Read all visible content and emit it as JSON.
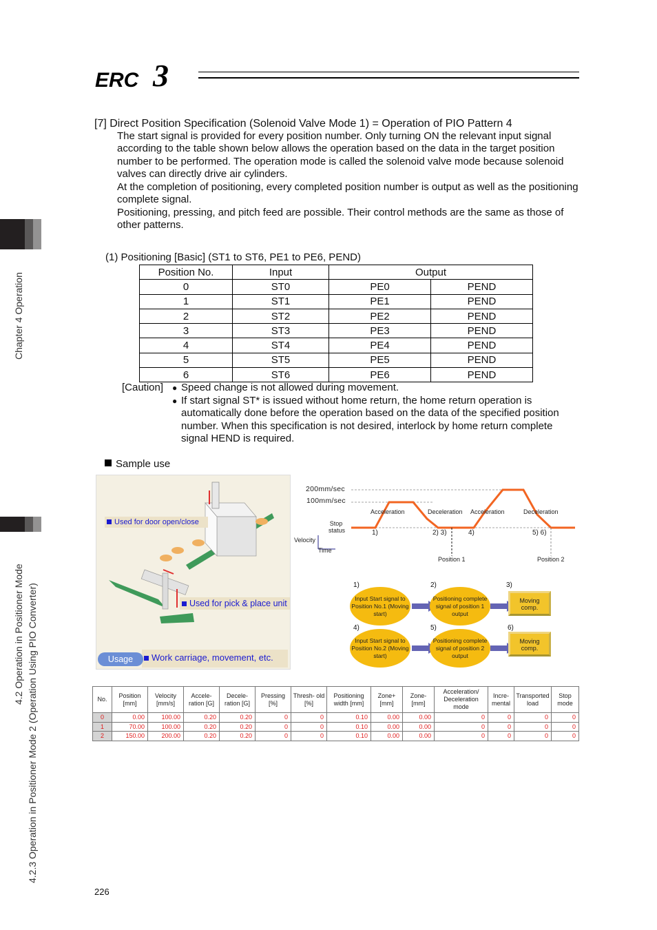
{
  "header": {
    "logo_text": "ERC3"
  },
  "side_tabs": {
    "chapter": "Chapter 4 Operation",
    "section_line1": "4.2 Operation in Positioner Mode",
    "section_line2": "4.2.3 Operation in Positioner Mode 2 (Operation Using PIO Converter)"
  },
  "section": {
    "title": "[7]  Direct Position Specification (Solenoid Valve Mode 1) = Operation of PIO Pattern 4",
    "paragraphs": [
      "The start signal is provided for every position number. Only turning ON the relevant input signal according to the table shown below allows the operation based on the data in the target position number to be performed. The operation mode is called the solenoid valve mode because solenoid valves can directly drive air cylinders.",
      "At the completion of positioning, every completed position number is output as well as the positioning complete signal.",
      "Positioning, pressing, and pitch feed are possible. Their control methods are the same as those of other patterns."
    ]
  },
  "signal_table": {
    "title": "(1) Positioning [Basic] (ST1 to ST6, PE1 to PE6, PEND)",
    "headers": [
      "Position No.",
      "Input",
      "Output"
    ],
    "rows": [
      [
        "0",
        "ST0",
        "PE0",
        "PEND"
      ],
      [
        "1",
        "ST1",
        "PE1",
        "PEND"
      ],
      [
        "2",
        "ST2",
        "PE2",
        "PEND"
      ],
      [
        "3",
        "ST3",
        "PE3",
        "PEND"
      ],
      [
        "4",
        "ST4",
        "PE4",
        "PEND"
      ],
      [
        "5",
        "ST5",
        "PE5",
        "PEND"
      ],
      [
        "6",
        "ST6",
        "PE6",
        "PEND"
      ]
    ]
  },
  "caution": {
    "label": "[Caution]",
    "bullets": [
      "Speed change is not allowed during movement.",
      "If start signal ST* is issued without home return, the home return operation is automatically done before the operation based on the data of the specified position number. When this specification is not desired, interlock by home return complete signal HEND is required."
    ]
  },
  "sample_use": {
    "heading": "Sample use",
    "illustration": {
      "label_door": "Used for door open/close",
      "label_pick": "Used for pick & place unit",
      "usage_badge": "Usage",
      "label_work": "Work carriage, movement, etc."
    },
    "timing_chart": {
      "speed_high": "200mm/sec",
      "speed_low": "100mm/sec",
      "phase_labels": [
        "Acceleration",
        "Deceleration",
        "Acceleration",
        "Deceleration"
      ],
      "stop_status": "Stop status",
      "step_markers": [
        "1)",
        "2) 3)",
        "4)",
        "5) 6)"
      ],
      "axis_velocity": "Velocity",
      "axis_time": "Time",
      "position_labels": [
        "Position 1",
        "Position 2"
      ],
      "line_color": "#f26522"
    },
    "flow": {
      "steps": [
        {
          "num": "1)",
          "text": "Input Start signal to Position No.1 (Moving start)"
        },
        {
          "num": "2)",
          "text": "Positioning complete signal of position 1 output"
        },
        {
          "num": "3)",
          "text": "Moving comp."
        },
        {
          "num": "4)",
          "text": "Input Start signal to Position No.2 (Moving start)"
        },
        {
          "num": "5)",
          "text": "Positioning complete signal of position 2 output"
        },
        {
          "num": "6)",
          "text": "Moving comp."
        }
      ]
    }
  },
  "position_data_table": {
    "headers": [
      "No.",
      "Position [mm]",
      "Velocity [mm/s]",
      "Accele- ration [G]",
      "Decele- ration [G]",
      "Pressing [%]",
      "Thresh- old [%]",
      "Positioning width [mm]",
      "Zone+ [mm]",
      "Zone- [mm]",
      "Acceleration/ Deceleration mode",
      "Incre- mental",
      "Transported load",
      "Stop mode"
    ],
    "rows": [
      [
        "0",
        "0.00",
        "100.00",
        "0.20",
        "0.20",
        "0",
        "0",
        "0.10",
        "0.00",
        "0.00",
        "0",
        "0",
        "0",
        "0"
      ],
      [
        "1",
        "70.00",
        "100.00",
        "0.20",
        "0.20",
        "0",
        "0",
        "0.10",
        "0.00",
        "0.00",
        "0",
        "0",
        "0",
        "0"
      ],
      [
        "2",
        "150.00",
        "200.00",
        "0.20",
        "0.20",
        "0",
        "0",
        "0.10",
        "0.00",
        "0.00",
        "0",
        "0",
        "0",
        "0"
      ]
    ]
  },
  "footer": {
    "page_number": "226"
  }
}
